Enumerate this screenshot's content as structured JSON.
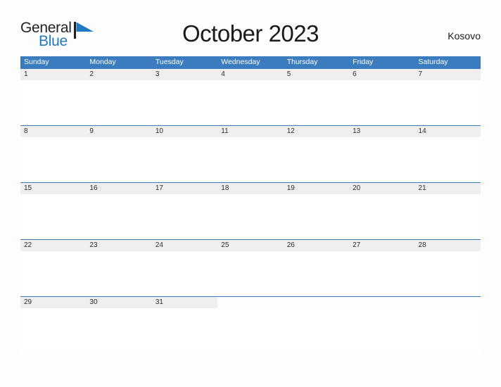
{
  "brand": {
    "name_top": "General",
    "name_bottom": "Blue",
    "accent_color": "#1f7bc1",
    "text_color": "#231f20"
  },
  "header": {
    "title": "October 2023",
    "region": "Kosovo"
  },
  "calendar": {
    "header_bg": "#3a7cbe",
    "band_bg": "#efefef",
    "weekdays": [
      "Sunday",
      "Monday",
      "Tuesday",
      "Wednesday",
      "Thursday",
      "Friday",
      "Saturday"
    ],
    "weeks": [
      [
        "1",
        "2",
        "3",
        "4",
        "5",
        "6",
        "7"
      ],
      [
        "8",
        "9",
        "10",
        "11",
        "12",
        "13",
        "14"
      ],
      [
        "15",
        "16",
        "17",
        "18",
        "19",
        "20",
        "21"
      ],
      [
        "22",
        "23",
        "24",
        "25",
        "26",
        "27",
        "28"
      ],
      [
        "29",
        "30",
        "31",
        "",
        "",
        "",
        ""
      ]
    ]
  }
}
